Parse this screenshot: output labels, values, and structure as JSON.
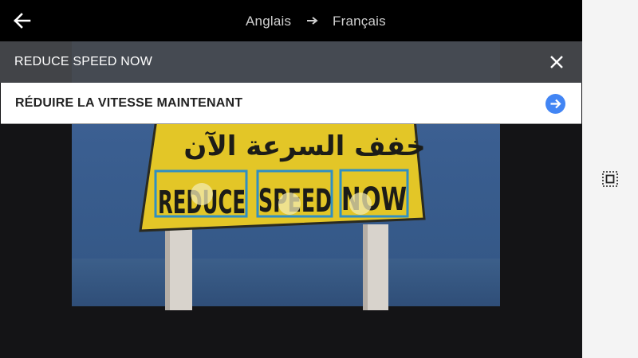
{
  "topbar": {
    "source_language": "Anglais",
    "target_language": "Français"
  },
  "source": {
    "text": "REDUCE SPEED NOW"
  },
  "translation": {
    "text": "RÉDUIRE LA VITESSE MAINTENANT"
  },
  "sign": {
    "arabic_text": "خفف السرعة الآن",
    "words": [
      "REDUCE",
      "SPEED",
      "NOW"
    ]
  },
  "colors": {
    "accent": "#4285f4",
    "highlight_box": "#2f8fc4",
    "sign_yellow": "#e3c627",
    "topbar": "#000000",
    "source_bar": "#46484c",
    "side_panel": "#f4f4f4"
  },
  "icons": {
    "back": "arrow-left-icon",
    "swap": "arrow-right-icon",
    "close": "close-icon",
    "go": "arrow-circle-right-icon",
    "select_all": "select-all-icon"
  }
}
